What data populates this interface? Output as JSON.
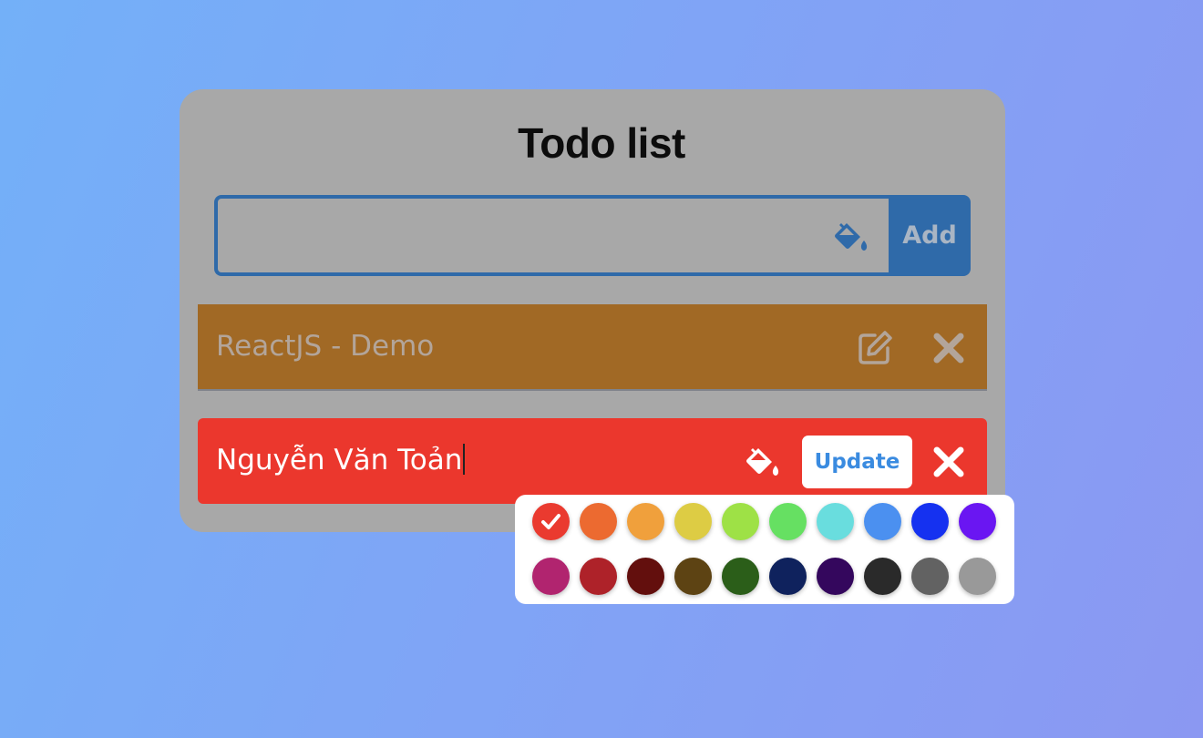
{
  "app": {
    "title": "Todo list"
  },
  "new_todo": {
    "input_value": "",
    "placeholder": "",
    "color_icon": "paint-bucket-icon",
    "add_label": "Add"
  },
  "todos": [
    {
      "text": "ReactJS - Demo",
      "color": "#a16925",
      "edit_icon": "edit-icon",
      "delete_icon": "close-icon"
    },
    {
      "text": "Nguyễn Văn Toản",
      "color": "#eb372d",
      "editing": true,
      "color_icon": "paint-bucket-icon",
      "update_label": "Update",
      "delete_icon": "close-icon"
    }
  ],
  "palette": {
    "selected_index": 0,
    "colors": [
      "#ea3a2f",
      "#ec6a30",
      "#f0a03c",
      "#ddcc44",
      "#9ee146",
      "#66e062",
      "#69ddde",
      "#4b90f0",
      "#1531f0",
      "#6a16f2",
      "#b1246f",
      "#ae2229",
      "#630f0d",
      "#5d4313",
      "#2b5e19",
      "#0f225d",
      "#34075d",
      "#2a2a2a",
      "#626262",
      "#999999"
    ]
  }
}
